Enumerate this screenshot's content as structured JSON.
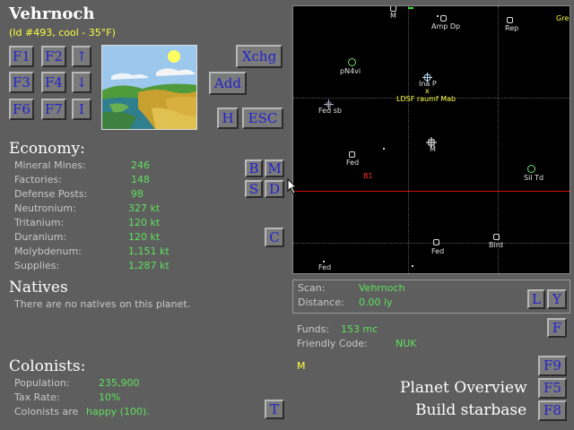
{
  "planet": {
    "name": "Vehrnoch",
    "subtitle": "(Id #493, cool - 35°F)"
  },
  "buttons": {
    "f1": "F1",
    "f2": "F2",
    "up": "↑",
    "f3": "F3",
    "f4": "F4",
    "down": "↓",
    "f6": "F6",
    "f7": "F7",
    "i": "I",
    "xchg": "Xchg",
    "add": "Add",
    "h": "H",
    "esc": "ESC",
    "b": "B",
    "m": "M",
    "s": "S",
    "d": "D",
    "c": "C",
    "t": "T",
    "l": "L",
    "y": "Y",
    "f": "F",
    "f9": "F9",
    "f5": "F5",
    "f8": "F8"
  },
  "economy": {
    "heading": "Economy:",
    "rows": [
      {
        "label": "Mineral Mines:",
        "value": "246"
      },
      {
        "label": "Factories:",
        "value": "148"
      },
      {
        "label": "Defense Posts:",
        "value": "98"
      },
      {
        "label": "Neutronium:",
        "value": "327 kt"
      },
      {
        "label": "Tritanium:",
        "value": "120 kt"
      },
      {
        "label": "Duranium:",
        "value": "120 kt"
      },
      {
        "label": "Molybdenum:",
        "value": "1,151 kt"
      },
      {
        "label": "Supplies:",
        "value": "1,287 kt"
      }
    ]
  },
  "natives": {
    "heading": "Natives",
    "text": "There are no natives on this planet."
  },
  "colonists": {
    "heading": "Colonists:",
    "population_label": "Population:",
    "population_value": "235,900",
    "tax_label": "Tax Rate:",
    "tax_value": "10%",
    "mood_prefix": "Colonists are",
    "mood_value": "happy (100)."
  },
  "map": {
    "labels": {
      "m_top": "M",
      "gre": "Gre",
      "amp_dp": "Amp Dp",
      "rep": "Rep",
      "pnavi": "pN4vi",
      "ina_p": "Ina P",
      "ldsf": "LDSF raumf Mab",
      "fed_sb": "Fed sb",
      "m_center": "M",
      "fed1": "Fed",
      "b1": "B1",
      "sil_td": "Sil Td",
      "fed2": "Fed",
      "bird": "Bird",
      "fed3": "Fed"
    }
  },
  "scan": {
    "scan_label": "Scan:",
    "scan_value": "Vehrnoch",
    "distance_label": "Distance:",
    "distance_value": "0.00 ly"
  },
  "funds": {
    "funds_label": "Funds:",
    "funds_value": "153 mc",
    "fc_label": "Friendly Code:",
    "fc_value": "NUK",
    "marker": "M"
  },
  "actions": {
    "planet_overview": "Planet Overview",
    "build_starbase": "Build starbase"
  },
  "colors": {
    "background": "#5e5e5e",
    "value_green": "#5ee05e",
    "highlight_yellow": "#ffff40",
    "button_text_blue": "#2222cc",
    "map_red_line": "#d01010"
  }
}
